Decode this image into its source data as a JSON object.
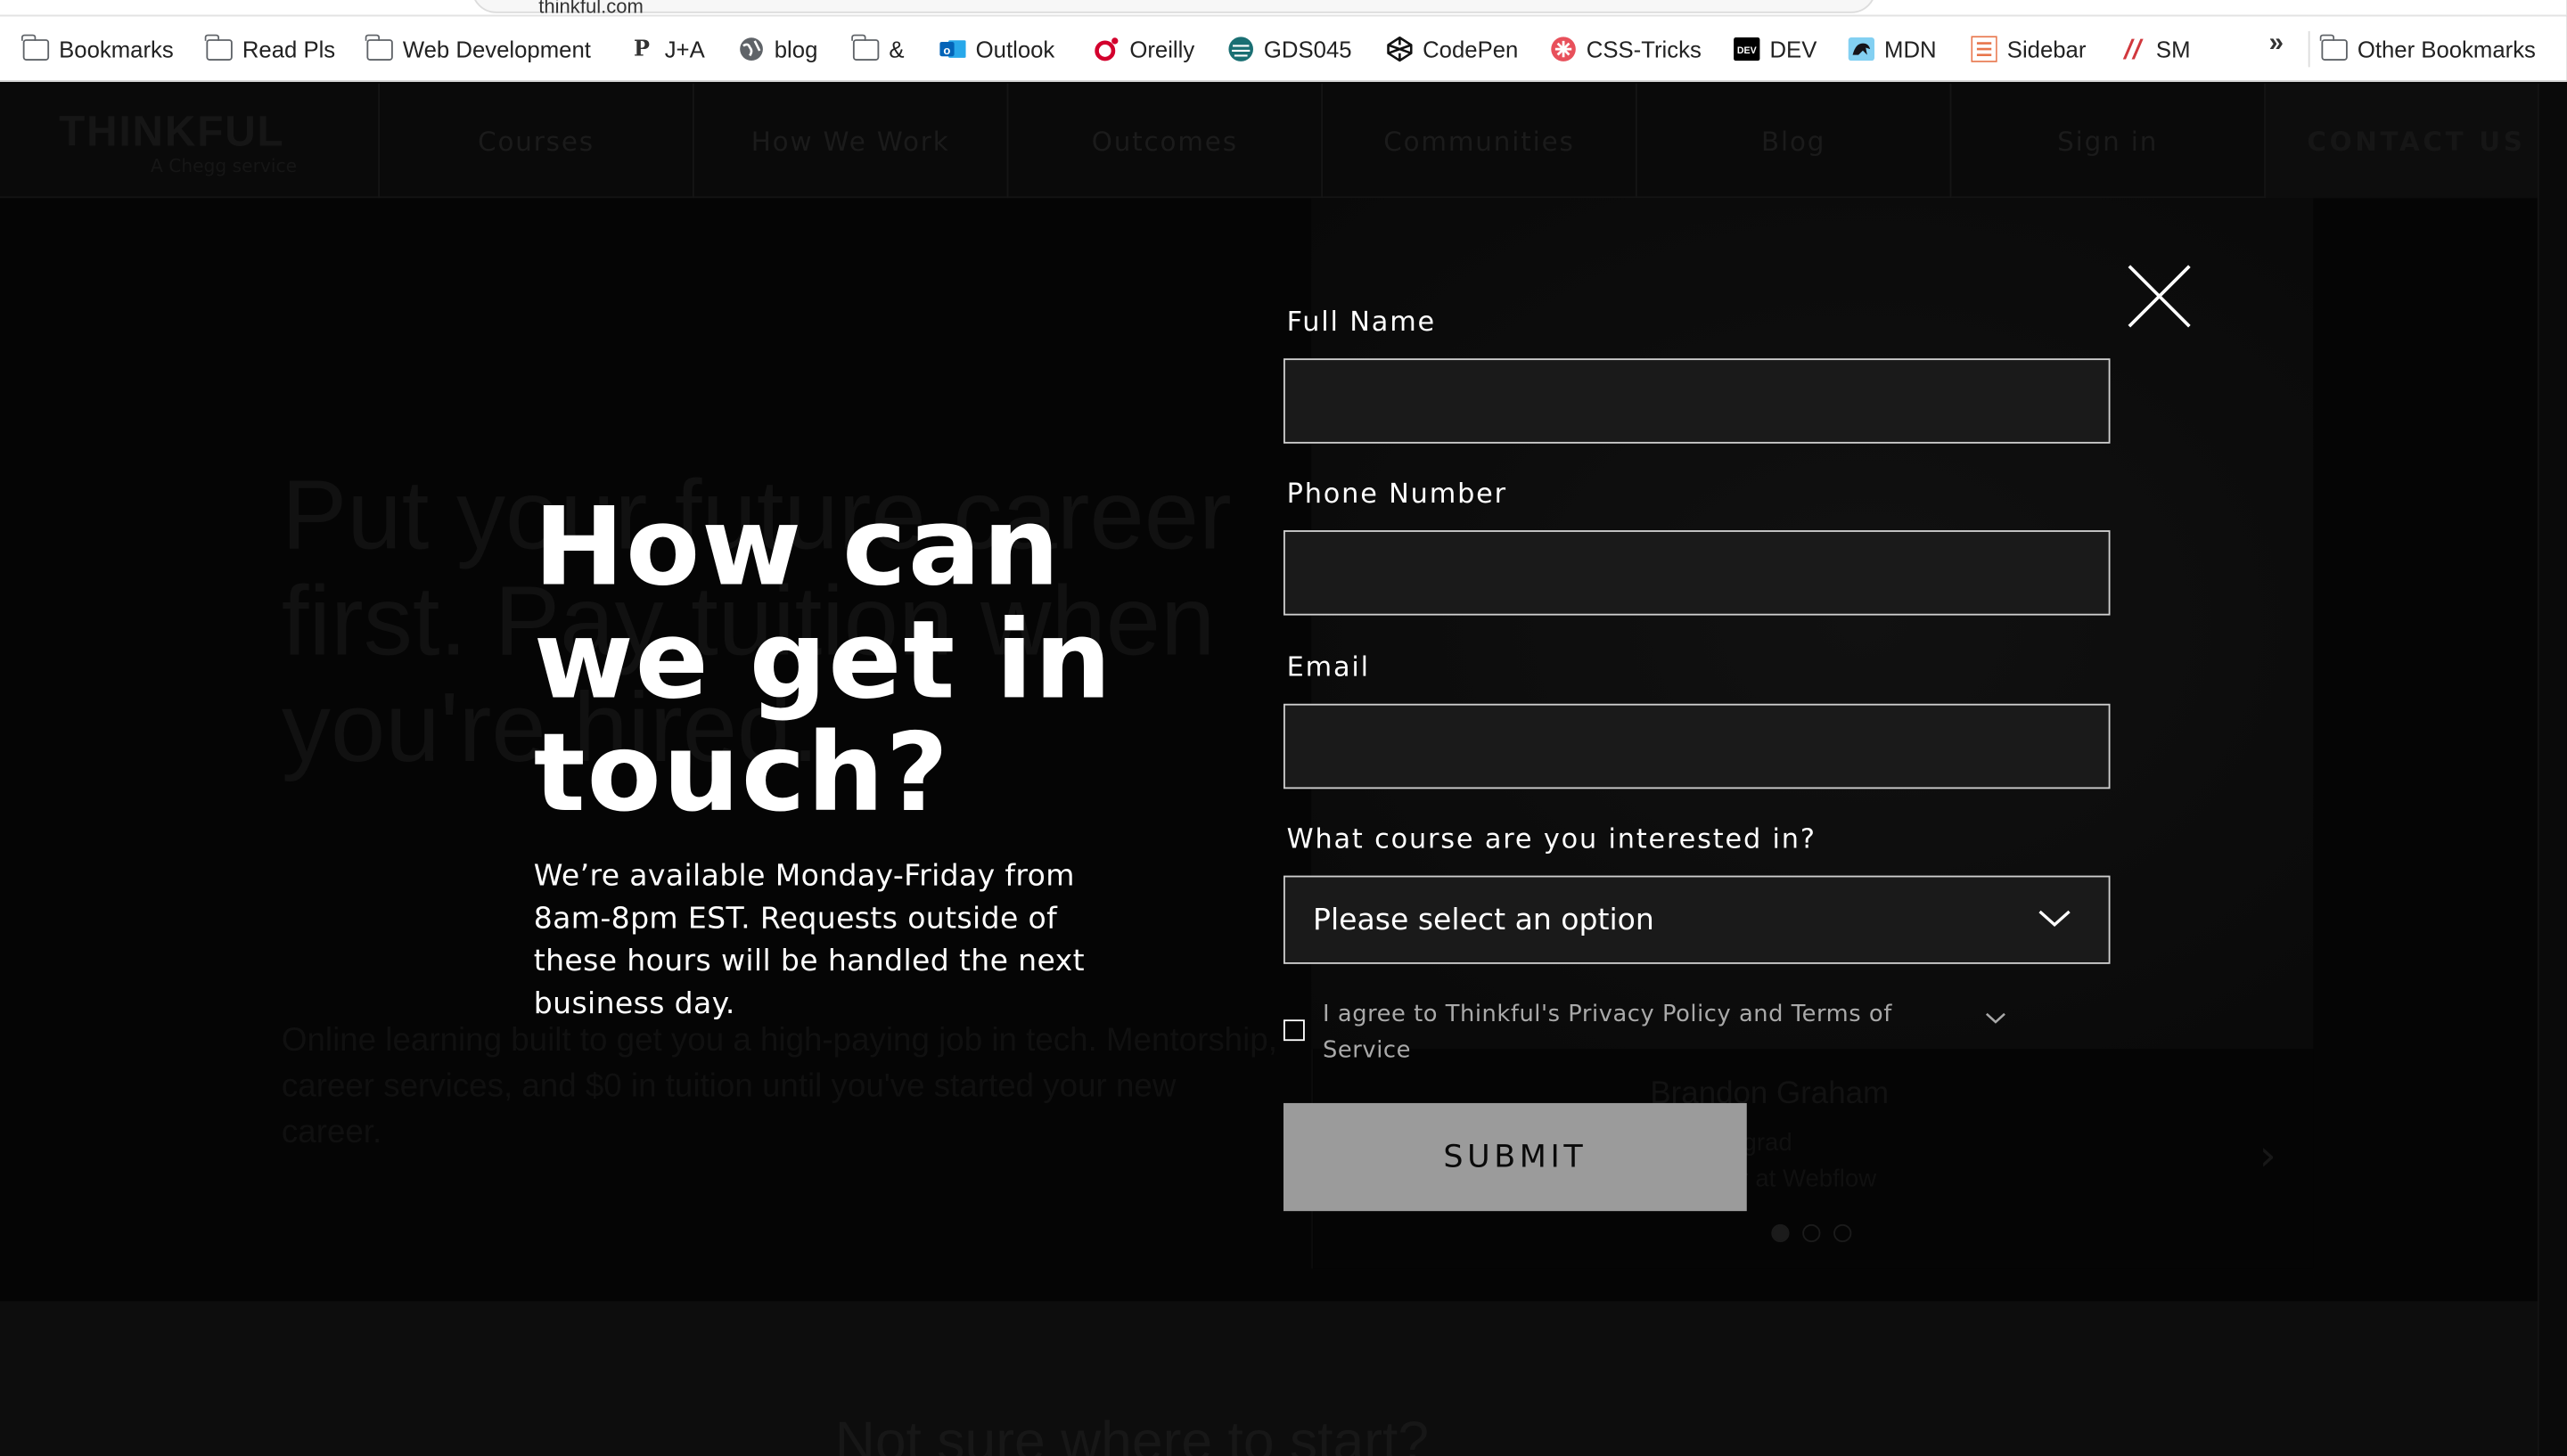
{
  "browser": {
    "url": "thinkful.com",
    "bookmarks": [
      {
        "label": "Bookmarks",
        "icon": "folder-icon"
      },
      {
        "label": "Read Pls",
        "icon": "folder-icon"
      },
      {
        "label": "Web Development",
        "icon": "folder-icon"
      },
      {
        "label": "J+A",
        "icon": "p-icon"
      },
      {
        "label": "blog",
        "icon": "globe-icon"
      },
      {
        "label": "&",
        "icon": "folder-icon"
      },
      {
        "label": "Outlook",
        "icon": "outlook-icon"
      },
      {
        "label": "Oreilly",
        "icon": "oreilly-icon"
      },
      {
        "label": "GDS045",
        "icon": "gds-icon"
      },
      {
        "label": "CodePen",
        "icon": "codepen-icon"
      },
      {
        "label": "CSS-Tricks",
        "icon": "css-tricks-icon"
      },
      {
        "label": "DEV",
        "icon": "dev-icon"
      },
      {
        "label": "MDN",
        "icon": "mdn-icon"
      },
      {
        "label": "Sidebar",
        "icon": "sidebar-icon"
      },
      {
        "label": "SM",
        "icon": "sm-icon"
      }
    ],
    "overflow_label": "»",
    "other_bookmarks": "Other Bookmarks"
  },
  "site": {
    "logo": "THINKFUL",
    "logo_sub": "A Chegg service",
    "nav": [
      "Courses",
      "How We Work",
      "Outcomes",
      "Communities",
      "Blog",
      "Sign in",
      "CONTACT US"
    ],
    "hero_heading": "Put your future career first. Pay tuition when you're hired.",
    "hero_sub": "Online learning built to get you a high-paying job in tech. Mentorship, career services, and $0 in tuition until you've started your new career.",
    "testimonial_name": "Brandon Graham",
    "testimonial_line1": "Thinkful grad",
    "testimonial_line2": "Engineer at Webflow",
    "next_arrow": "›",
    "lower_heading": "Not sure where to start?"
  },
  "modal": {
    "title": "How can we get in touch?",
    "description": "We’re available Monday-Friday from 8am-8pm EST. Requests outside of these hours will be handled the next business day.",
    "fields": {
      "full_name_label": "Full Name",
      "full_name_value": "",
      "phone_label": "Phone Number",
      "phone_value": "",
      "email_label": "Email",
      "email_value": "",
      "course_label": "What course are you interested in?",
      "course_selected": "Please select an option"
    },
    "agree_text": "I agree to Thinkful's Privacy Policy and Terms of Service",
    "agree_checked": false,
    "submit_label": "SUBMIT"
  },
  "colors": {
    "overlay": "#050505",
    "text": "#ffffff",
    "input_bg": "#1a1a1a",
    "input_border": "#cfcfcf",
    "submit_bg": "#9b9b9b",
    "muted_text": "#a9a9a9"
  }
}
